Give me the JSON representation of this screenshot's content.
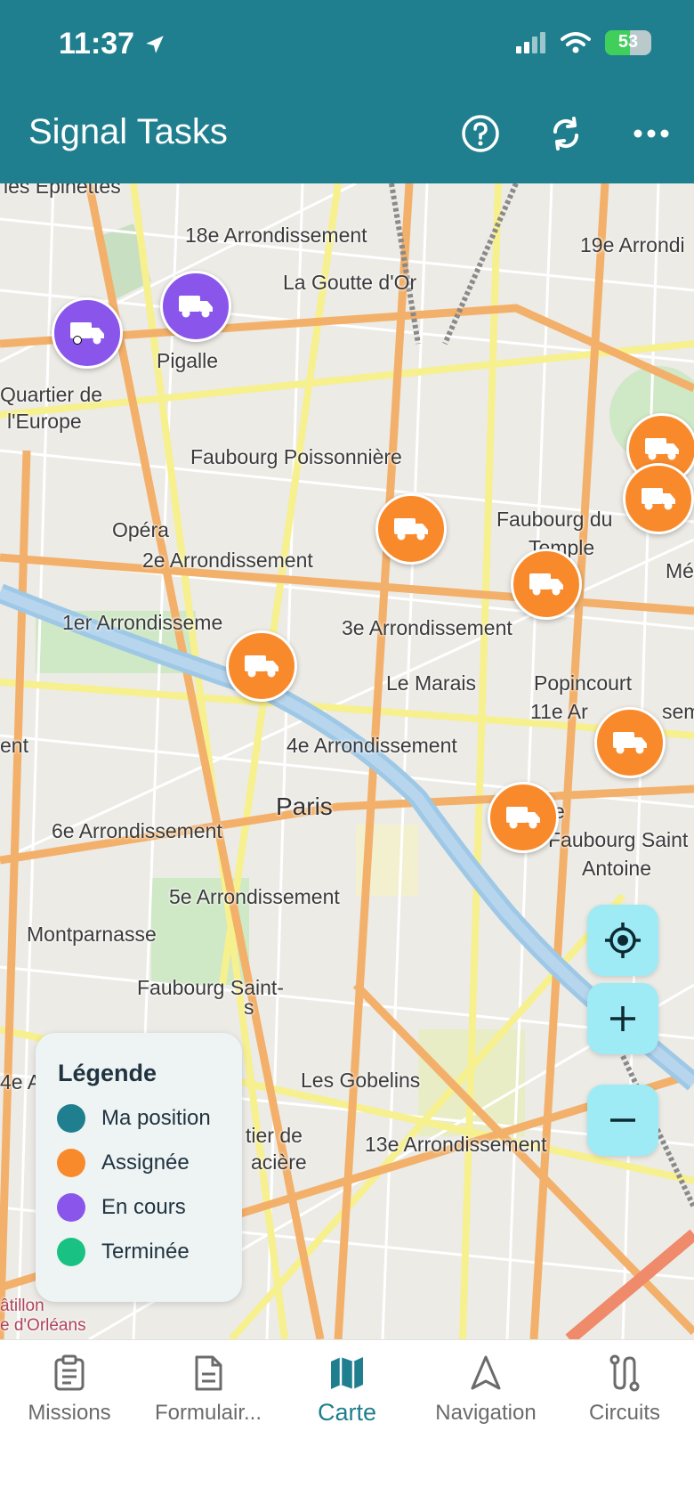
{
  "status_bar": {
    "time": "11:37",
    "battery": "53"
  },
  "header": {
    "title": "Signal Tasks"
  },
  "map": {
    "places": [
      "les Épinettes",
      "18e Arrondissement",
      "19e Arrondi",
      "La Goutte d'Or",
      "Pigalle",
      "Quartier de",
      "l'Europe",
      "Faubourg Poissonnière",
      "Opéra",
      "2e Arrondissement",
      "Faubourg du",
      "Temple",
      "1er Arrondisseme",
      "3e Arrondissement",
      "Le Marais",
      "Popincourt",
      "11e Ar",
      "sem",
      "4e Arrondissement",
      "Paris",
      "6e Arrondissement",
      "Faubourg Saint",
      "Antoine",
      "5e Arrondissement",
      "Montparnasse",
      "Faubourg Saint-",
      "Les Gobelins",
      "13e Arrondissement",
      "tier de",
      "acière",
      "ent",
      "Mé",
      "4e A",
      "âtillon",
      "e d'Orléans",
      "e",
      "s"
    ],
    "markers": [
      {
        "status": "En cours"
      },
      {
        "status": "En cours"
      },
      {
        "status": "Assignée"
      },
      {
        "status": "Assignée"
      },
      {
        "status": "Assignée"
      },
      {
        "status": "Assignée"
      },
      {
        "status": "Assignée"
      },
      {
        "status": "Assignée"
      },
      {
        "status": "Assignée"
      }
    ]
  },
  "legend": {
    "title": "Légende",
    "items": [
      {
        "label": "Ma position",
        "color": "#1f7f8e"
      },
      {
        "label": "Assignée",
        "color": "#f98a2c"
      },
      {
        "label": "En cours",
        "color": "#8a55ea"
      },
      {
        "label": "Terminée",
        "color": "#19c283"
      }
    ]
  },
  "tabs": [
    {
      "label": "Missions",
      "icon": "clipboard-icon"
    },
    {
      "label": "Formulair...",
      "icon": "document-icon"
    },
    {
      "label": "Carte",
      "icon": "map-icon",
      "active": true
    },
    {
      "label": "Navigation",
      "icon": "navigation-arrow-icon"
    },
    {
      "label": "Circuits",
      "icon": "route-icon"
    }
  ],
  "colors": {
    "primary": "#1f7f8e",
    "assigned": "#f98a2c",
    "in_progress": "#8a55ea",
    "done": "#19c283",
    "control_bg": "#9eeaf5"
  }
}
